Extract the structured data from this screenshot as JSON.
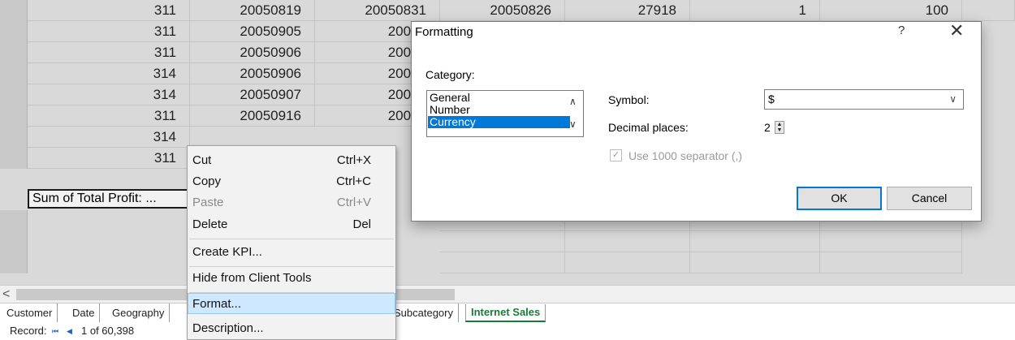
{
  "grid": {
    "rows": [
      [
        "311",
        "20050819",
        "20050831",
        "20050826",
        "27918",
        "1",
        "100"
      ],
      [
        "311",
        "20050905",
        "20050",
        "",
        "",
        "",
        ""
      ],
      [
        "311",
        "20050906",
        "20050",
        "",
        "",
        "",
        ""
      ],
      [
        "314",
        "20050906",
        "20050",
        "",
        "",
        "",
        ""
      ],
      [
        "314",
        "20050907",
        "20050",
        "",
        "",
        "",
        ""
      ],
      [
        "311",
        "20050916",
        "20050",
        "",
        "",
        "",
        ""
      ],
      [
        "314",
        "",
        "",
        "",
        "",
        "",
        ""
      ],
      [
        "311",
        "",
        "",
        "",
        "",
        "",
        ""
      ]
    ],
    "measure_cell": "Sum of Total Profit: ..."
  },
  "hscroll": {
    "left_arrow": "<"
  },
  "tabs": [
    "Customer",
    "Date",
    "Geography",
    "Subcategory",
    "Internet Sales"
  ],
  "active_tab": "Internet Sales",
  "status": {
    "record_label": "Record:",
    "nav_first": "⏮",
    "nav_prev": "◀",
    "position": "1 of 60,398"
  },
  "context_menu": {
    "cut": {
      "label": "Cut",
      "shortcut": "Ctrl+X"
    },
    "copy": {
      "label": "Copy",
      "shortcut": "Ctrl+C"
    },
    "paste": {
      "label": "Paste",
      "shortcut": "Ctrl+V"
    },
    "delete": {
      "label": "Delete",
      "shortcut": "Del"
    },
    "create_kpi": "Create KPI...",
    "hide": "Hide from Client Tools",
    "format": "Format...",
    "description": "Description..."
  },
  "dialog": {
    "title": "Formatting",
    "help": "?",
    "close": "✕",
    "category_label": "Category:",
    "categories": [
      "General",
      "Number",
      "Currency"
    ],
    "selected_category": "Currency",
    "symbol_label": "Symbol:",
    "symbol_value": "$",
    "decimal_label": "Decimal places:",
    "decimal_value": "2",
    "separator_label": "Use 1000 separator (,)",
    "separator_checked": true,
    "ok": "OK",
    "cancel": "Cancel"
  },
  "colors": {
    "selection": "#0078d7",
    "menu_highlight": "#cde8ff",
    "active_tab": "#1a7a3a"
  }
}
